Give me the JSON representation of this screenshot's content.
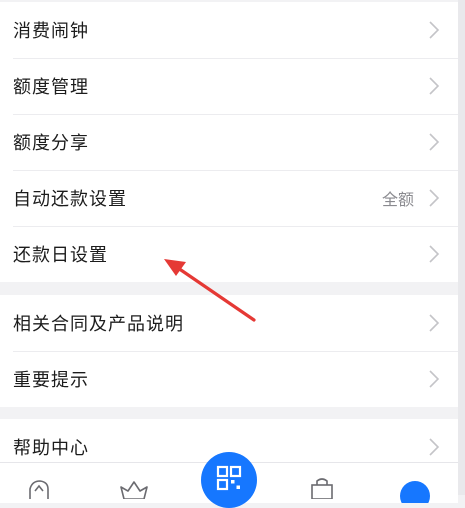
{
  "menu_group_1": [
    {
      "label": "消费闹钟",
      "value": ""
    },
    {
      "label": "额度管理",
      "value": ""
    },
    {
      "label": "额度分享",
      "value": ""
    },
    {
      "label": "自动还款设置",
      "value": "全额"
    },
    {
      "label": "还款日设置",
      "value": ""
    }
  ],
  "menu_group_2": [
    {
      "label": "相关合同及产品说明",
      "value": ""
    },
    {
      "label": "重要提示",
      "value": ""
    }
  ],
  "menu_group_3": [
    {
      "label": "帮助中心",
      "value": ""
    }
  ],
  "colors": {
    "accent": "#1677ff",
    "annotation_arrow": "#e53935",
    "background": "#f2f2f4"
  }
}
